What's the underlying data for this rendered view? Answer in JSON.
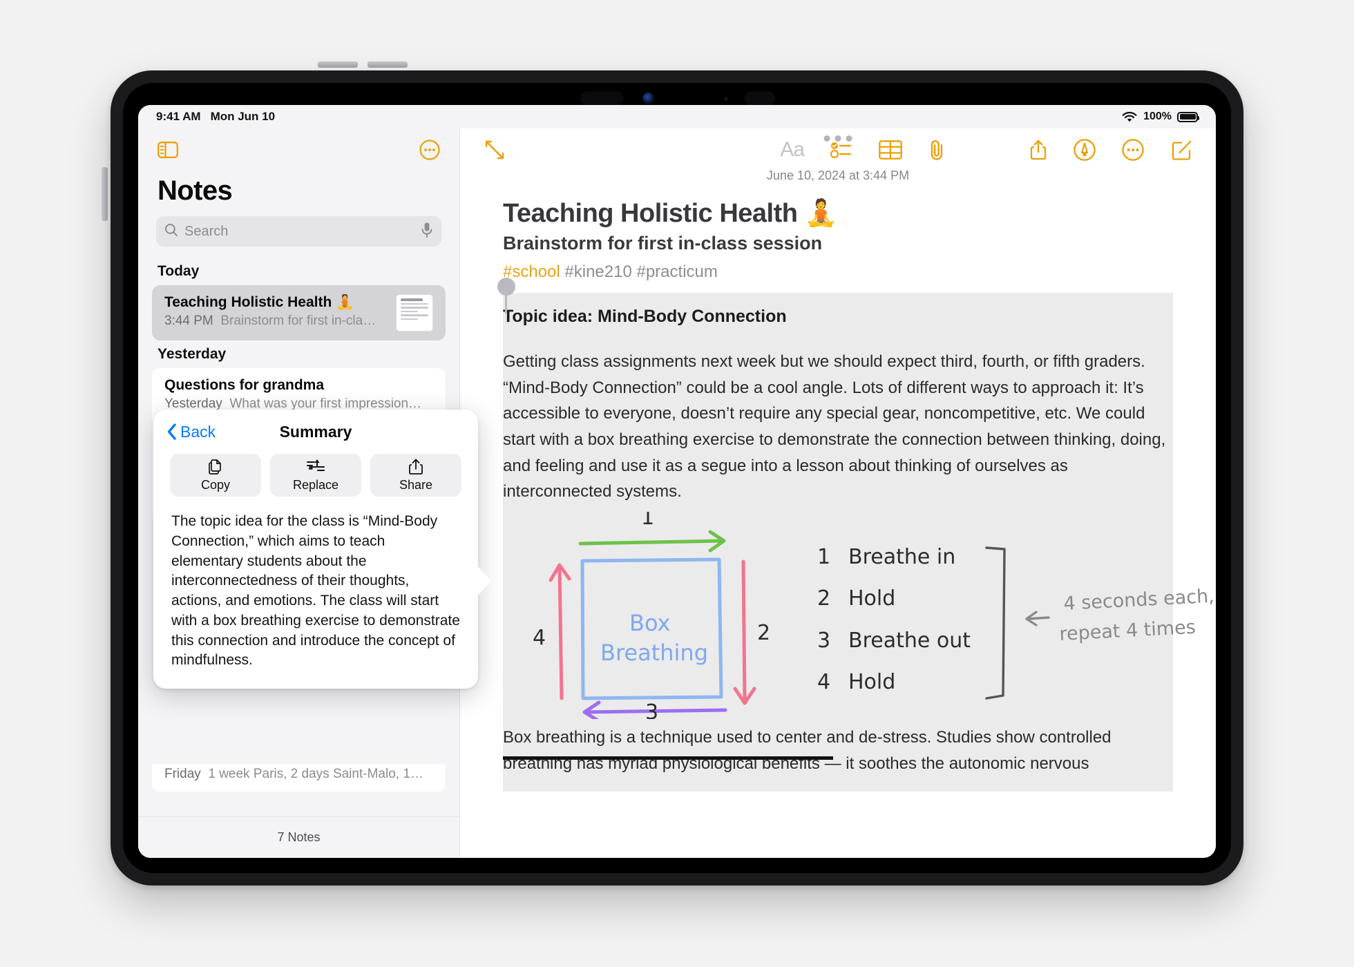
{
  "status_bar": {
    "time": "9:41 AM",
    "date": "Mon Jun 10",
    "battery_percent": "100%",
    "wifi_icon": "wifi-icon",
    "battery_icon": "battery-full-icon"
  },
  "sidebar": {
    "sidebar_toggle_icon": "sidebar-toggle-icon",
    "more_icon": "ellipsis-circle-icon",
    "title": "Notes",
    "search": {
      "placeholder": "Search",
      "icon": "search-icon",
      "mic_icon": "microphone-icon"
    },
    "sections": [
      {
        "header": "Today",
        "notes": [
          {
            "title": "Teaching Holistic Health 🧘",
            "time": "3:44 PM",
            "preview": "Brainstorm for first in-cla…",
            "selected": true,
            "has_thumbnail": true
          }
        ]
      },
      {
        "header": "Yesterday",
        "notes": [
          {
            "title": "Questions for grandma",
            "time": "Yesterday",
            "preview": "What was your first impression…",
            "selected": false,
            "has_thumbnail": false
          },
          {
            "title": "",
            "time": "Friday",
            "preview": "1 week Paris, 2 days Saint-Malo, 1…",
            "selected": false,
            "has_thumbnail": false
          }
        ]
      }
    ],
    "footer_count": "7 Notes"
  },
  "popover": {
    "back_label": "Back",
    "back_icon": "chevron-left-icon",
    "title": "Summary",
    "actions": [
      {
        "label": "Copy",
        "icon": "copy-icon"
      },
      {
        "label": "Replace",
        "icon": "replace-text-icon"
      },
      {
        "label": "Share",
        "icon": "share-icon"
      }
    ],
    "summary_text": "The topic idea for the class is “Mind-Body Connection,” which aims to teach elementary students about the interconnectedness of their thoughts, actions, and emotions. The class will start with a box breathing exercise to demonstrate this connection and introduce the concept of mindfulness."
  },
  "editor": {
    "grab_handle_icon": "multitask-handle-icon",
    "toolbar": {
      "expand_icon": "expand-diagonal-icon",
      "format_label": "Aa",
      "format_icon": "text-format-icon",
      "checklist_icon": "checklist-icon",
      "table_icon": "table-icon",
      "attach_icon": "paperclip-icon",
      "share_icon": "share-up-icon",
      "markup_icon": "markup-pen-circle-icon",
      "more_icon": "ellipsis-circle-icon",
      "compose_icon": "compose-square-icon"
    },
    "timestamp": "June 10, 2024 at 3:44 PM",
    "title": "Teaching Holistic Health 🧘",
    "subtitle": "Brainstorm for first in-class session",
    "tags": {
      "highlighted": "#school",
      "rest": " #kine210 #practicum"
    },
    "selection": {
      "heading": "Topic idea: Mind-Body Connection",
      "paragraph": "Getting class assignments next week but we should expect third, fourth, or fifth graders. “Mind-Body Connection” could be a cool angle. Lots of different ways to approach it: It’s accessible to everyone, doesn’t require any special gear, noncompetitive, etc. We could start with a box breathing exercise to demonstrate the connection between thinking, doing, and feeling and use it as a segue into a lesson about thinking of ourselves as interconnected systems."
    },
    "sketch": {
      "box_label_line1": "Box",
      "box_label_line2": "Breathing",
      "arrow_labels": {
        "top": "1",
        "right": "2",
        "bottom": "3",
        "left": "4"
      },
      "arrow_colors": {
        "top": "#6cc24a",
        "right": "#f2748f",
        "bottom": "#9b6ef3",
        "left": "#f2748f"
      },
      "box_color": "#8fb6f0",
      "steps": [
        {
          "num": "1",
          "text": "Breathe in"
        },
        {
          "num": "2",
          "text": "Hold"
        },
        {
          "num": "3",
          "text": "Breathe out"
        },
        {
          "num": "4",
          "text": "Hold"
        }
      ],
      "annotation_line1": "4 seconds each,",
      "annotation_line2": "repeat 4 times",
      "annotation_arrow_icon": "arrow-left-icon"
    },
    "trailing_paragraph": "Box breathing is a technique used to center and de-stress. Studies show controlled breathing has myriad physiological benefits — it soothes the autonomic nervous"
  },
  "colors": {
    "accent": "#eba007",
    "link": "#067cf9",
    "selection_bg": "#ebebeb",
    "sidebar_bg": "#f4f4f7"
  }
}
